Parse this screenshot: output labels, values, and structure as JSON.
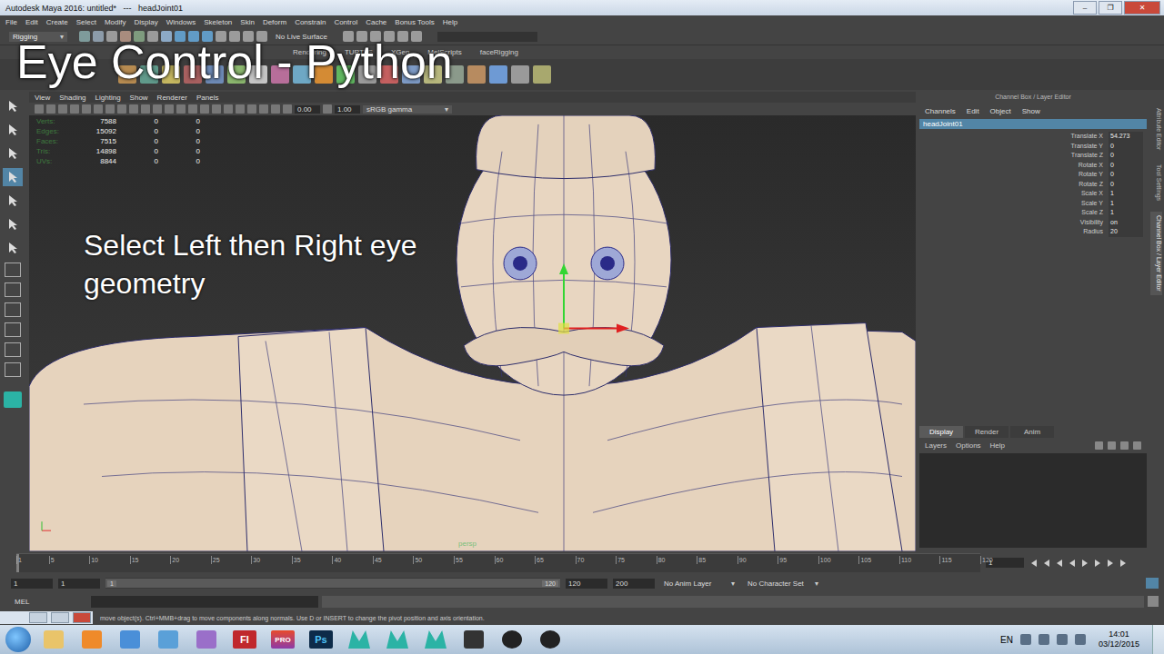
{
  "window": {
    "title": "Autodesk Maya 2016: untitled*   ---   headJoint01",
    "controls": [
      "–",
      "❐",
      "✕"
    ]
  },
  "menu": [
    "File",
    "Edit",
    "Create",
    "Select",
    "Modify",
    "Display",
    "Windows",
    "Skeleton",
    "Skin",
    "Deform",
    "Constrain",
    "Control",
    "Cache",
    "Bonus Tools",
    "Help"
  ],
  "status_line": {
    "mode": "Rigging",
    "live_surface": "No Live Surface"
  },
  "shelf_tabs": [
    "Rendering",
    "TURTLE",
    "XGen",
    "MelScripts",
    "faceRigging"
  ],
  "overlay": {
    "title": "Eye Control - Python",
    "instruction": "Select Left then Right eye geometry"
  },
  "viewport": {
    "menu": [
      "View",
      "Shading",
      "Lighting",
      "Show",
      "Renderer",
      "Panels"
    ],
    "exposure": "0.00",
    "gamma": "1.00",
    "color_space": "sRGB gamma",
    "hud": [
      {
        "label": "Verts:",
        "values": [
          "7588",
          "0",
          "0"
        ]
      },
      {
        "label": "Edges:",
        "values": [
          "15092",
          "0",
          "0"
        ]
      },
      {
        "label": "Faces:",
        "values": [
          "7515",
          "0",
          "0"
        ]
      },
      {
        "label": "Tris:",
        "values": [
          "14898",
          "0",
          "0"
        ]
      },
      {
        "label": "UVs:",
        "values": [
          "8844",
          "0",
          "0"
        ]
      }
    ],
    "camera": "persp"
  },
  "channel_box": {
    "title": "Channel Box / Layer Editor",
    "menu": [
      "Channels",
      "Edit",
      "Object",
      "Show"
    ],
    "node": "headJoint01",
    "attributes": [
      {
        "name": "Translate X",
        "value": "54.273"
      },
      {
        "name": "Translate Y",
        "value": "0"
      },
      {
        "name": "Translate Z",
        "value": "0"
      },
      {
        "name": "Rotate X",
        "value": "0"
      },
      {
        "name": "Rotate Y",
        "value": "0"
      },
      {
        "name": "Rotate Z",
        "value": "0"
      },
      {
        "name": "Scale X",
        "value": "1"
      },
      {
        "name": "Scale Y",
        "value": "1"
      },
      {
        "name": "Scale Z",
        "value": "1"
      },
      {
        "name": "Visibility",
        "value": "on"
      },
      {
        "name": "Radius",
        "value": "20"
      }
    ]
  },
  "side_tabs": [
    "Attribute Editor",
    "Tool Settings",
    "Channel Box / Layer Editor"
  ],
  "layer_editor": {
    "tabs": [
      {
        "label": "Display",
        "selected": true
      },
      {
        "label": "Render",
        "selected": false
      },
      {
        "label": "Anim",
        "selected": false
      }
    ],
    "menu": [
      "Layers",
      "Options",
      "Help"
    ]
  },
  "time_slider": {
    "ticks": [
      "1",
      "5",
      "10",
      "15",
      "20",
      "25",
      "30",
      "35",
      "40",
      "45",
      "50",
      "55",
      "60",
      "65",
      "70",
      "75",
      "80",
      "85",
      "90",
      "95",
      "100",
      "105",
      "110",
      "115",
      "120"
    ],
    "current_frame": "1"
  },
  "range_slider": {
    "start": "1",
    "playback_start": "1",
    "handle_start": "1",
    "handle_end": "120",
    "playback_end": "120",
    "end": "200",
    "anim_layer": "No Anim Layer",
    "character_set": "No Character Set"
  },
  "command_line": {
    "language": "MEL"
  },
  "help_line": "move object(s). Ctrl+MMB+drag to move components along normals. Use D or INSERT to change the pivot position and axis orientation.",
  "taskbar": {
    "apps": [
      "Fl",
      "PRO",
      "Ps"
    ],
    "language": "EN",
    "time": "14:01",
    "date": "03/12/2015"
  }
}
